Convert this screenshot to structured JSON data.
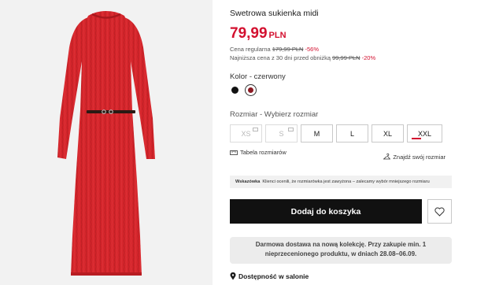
{
  "product": {
    "title": "Swetrowa sukienka midi",
    "price": "79,99",
    "currency": "PLN",
    "regular_label": "Cena regularna",
    "regular_price": "179,99 PLN",
    "regular_discount": "-56%",
    "lowest_label": "Najniższa cena z 30 dni przed obniżką",
    "lowest_price": "99,99 PLN",
    "lowest_discount": "-20%"
  },
  "color": {
    "label": "Kolor - czerwony",
    "swatches": [
      {
        "name": "black",
        "hex": "#111111"
      },
      {
        "name": "red",
        "hex": "#8b1a23",
        "selected": true
      }
    ]
  },
  "size": {
    "label": "Rozmiar - Wybierz rozmiar",
    "options": [
      {
        "label": "XS",
        "available": false
      },
      {
        "label": "S",
        "available": false
      },
      {
        "label": "M",
        "available": true
      },
      {
        "label": "L",
        "available": true
      },
      {
        "label": "XL",
        "available": true
      },
      {
        "label": "XXL",
        "available": true,
        "low_stock": true
      }
    ],
    "table_link": "Tabela rozmiarów",
    "find_link": "Znajdź swój rozmiar"
  },
  "tip": {
    "title": "Wskazówka",
    "text": "Klienci ocenili, że rozmiarówka jest zawyżona – zalecamy wybór mniejszego rozmiaru"
  },
  "actions": {
    "add_to_cart": "Dodaj do koszyka"
  },
  "delivery": {
    "line1": "Darmowa dostawa na nową kolekcję. Przy zakupie min. 1",
    "line2": "nieprzecenionego produktu, w dniach 28.08–06.09."
  },
  "store": {
    "availability": "Dostępność w salonie"
  },
  "colors": {
    "accent": "#d3102f",
    "dress": "#d3252b"
  }
}
